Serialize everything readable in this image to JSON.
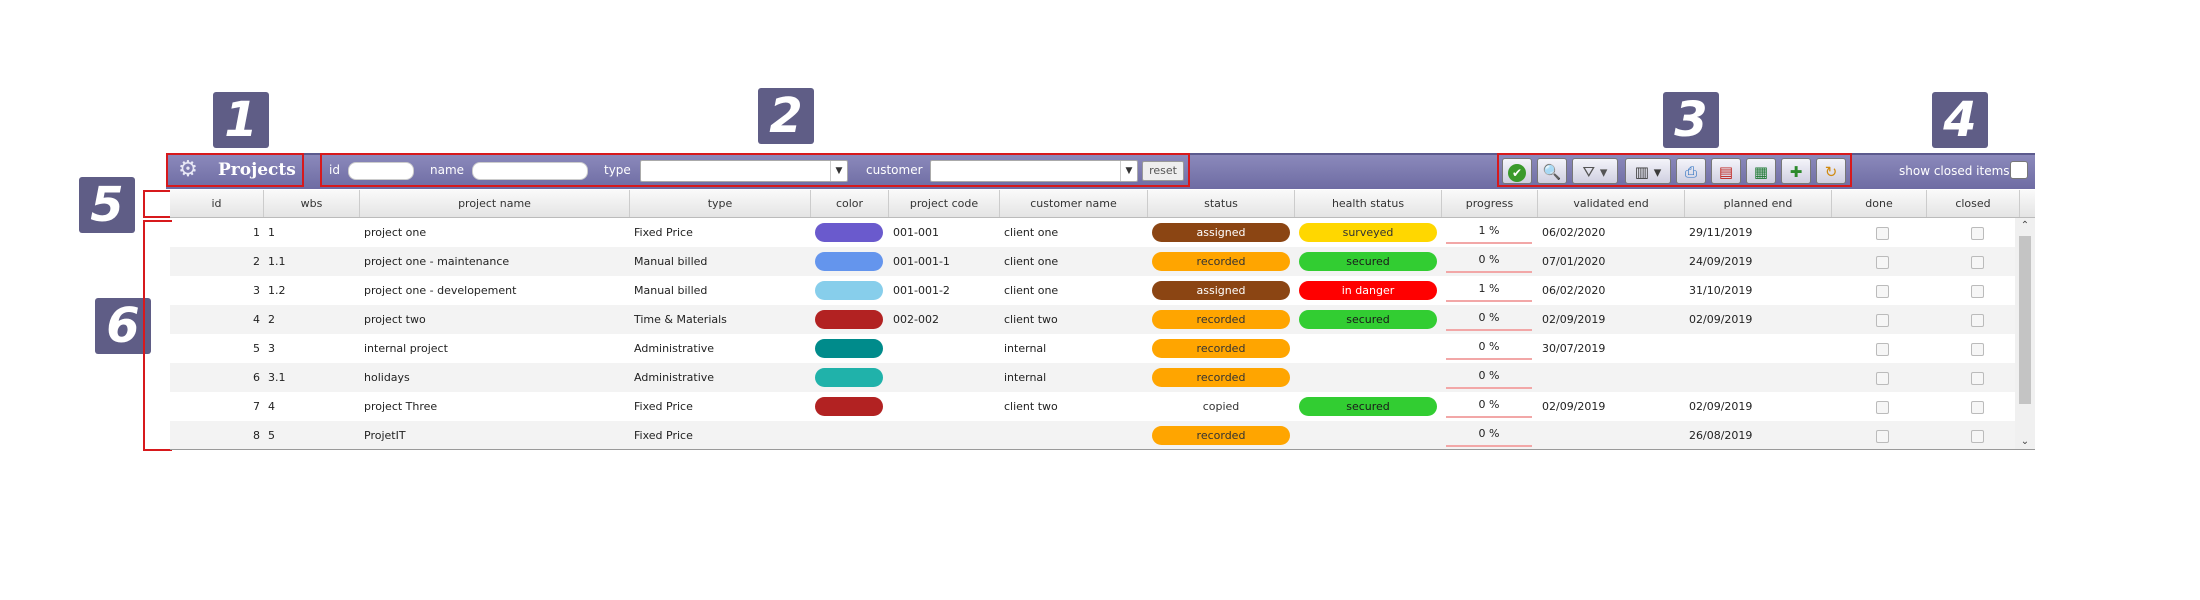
{
  "callouts": [
    "1",
    "2",
    "3",
    "4",
    "5",
    "6"
  ],
  "toolbar": {
    "title": "Projects",
    "logo_icon": "gear-logo-icon",
    "filters": {
      "id_label": "id",
      "name_label": "name",
      "type_label": "type",
      "customer_label": "customer",
      "reset_label": "reset"
    },
    "buttons": [
      "refresh-check-icon",
      "search-icon",
      "filter-icon",
      "columns-icon",
      "print-icon",
      "pdf-icon",
      "excel-icon",
      "new-item-icon",
      "undo-icon"
    ],
    "show_closed_label": "show closed items"
  },
  "grid": {
    "columns": [
      "id",
      "wbs",
      "project name",
      "type",
      "color",
      "project code",
      "customer name",
      "status",
      "health status",
      "progress",
      "validated end",
      "planned end",
      "done",
      "closed"
    ],
    "rows": [
      {
        "id": "1",
        "wbs": "1",
        "name": "project one",
        "type": "Fixed Price",
        "color": "#6a5acd",
        "code": "001-001",
        "customer": "client one",
        "status": "assigned",
        "status_color": "#8b4513",
        "status_text": "#ffffff",
        "health": "surveyed",
        "health_color": "#ffd700",
        "health_text": "#333333",
        "progress": "1 %",
        "validated": "06/02/2020",
        "planned": "29/11/2019"
      },
      {
        "id": "2",
        "wbs": "1.1",
        "name": "project one - maintenance",
        "type": "Manual billed",
        "color": "#6495ed",
        "code": "001-001-1",
        "customer": "client one",
        "status": "recorded",
        "status_color": "#ffa500",
        "status_text": "#333333",
        "health": "secured",
        "health_color": "#32cd32",
        "health_text": "#1a1a1a",
        "progress": "0 %",
        "validated": "07/01/2020",
        "planned": "24/09/2019"
      },
      {
        "id": "3",
        "wbs": "1.2",
        "name": "project one - developement",
        "type": "Manual billed",
        "color": "#87ceeb",
        "code": "001-001-2",
        "customer": "client one",
        "status": "assigned",
        "status_color": "#8b4513",
        "status_text": "#ffffff",
        "health": "in danger",
        "health_color": "#ff0000",
        "health_text": "#ffffff",
        "progress": "1 %",
        "validated": "06/02/2020",
        "planned": "31/10/2019"
      },
      {
        "id": "4",
        "wbs": "2",
        "name": "project two",
        "type": "Time & Materials",
        "color": "#b22222",
        "code": "002-002",
        "customer": "client two",
        "status": "recorded",
        "status_color": "#ffa500",
        "status_text": "#333333",
        "health": "secured",
        "health_color": "#32cd32",
        "health_text": "#1a1a1a",
        "progress": "0 %",
        "validated": "02/09/2019",
        "planned": "02/09/2019"
      },
      {
        "id": "5",
        "wbs": "3",
        "name": "internal project",
        "type": "Administrative",
        "color": "#008b8b",
        "code": "",
        "customer": "internal",
        "status": "recorded",
        "status_color": "#ffa500",
        "status_text": "#333333",
        "health": "",
        "health_color": "",
        "health_text": "",
        "progress": "0 %",
        "validated": "30/07/2019",
        "planned": ""
      },
      {
        "id": "6",
        "wbs": "3.1",
        "name": "holidays",
        "type": "Administrative",
        "color": "#20b2aa",
        "code": "",
        "customer": "internal",
        "status": "recorded",
        "status_color": "#ffa500",
        "status_text": "#333333",
        "health": "",
        "health_color": "",
        "health_text": "",
        "progress": "0 %",
        "validated": "",
        "planned": ""
      },
      {
        "id": "7",
        "wbs": "4",
        "name": "project Three",
        "type": "Fixed Price",
        "color": "#b22222",
        "code": "",
        "customer": "client two",
        "status": "copied",
        "status_color": "",
        "status_text": "#333333",
        "health": "secured",
        "health_color": "#32cd32",
        "health_text": "#1a1a1a",
        "progress": "0 %",
        "validated": "02/09/2019",
        "planned": "02/09/2019"
      },
      {
        "id": "8",
        "wbs": "5",
        "name": "ProjetIT",
        "type": "Fixed Price",
        "color": "",
        "code": "",
        "customer": "",
        "status": "recorded",
        "status_color": "#ffa500",
        "status_text": "#333333",
        "health": "",
        "health_color": "",
        "health_text": "",
        "progress": "0 %",
        "validated": "",
        "planned": "26/08/2019"
      }
    ]
  }
}
